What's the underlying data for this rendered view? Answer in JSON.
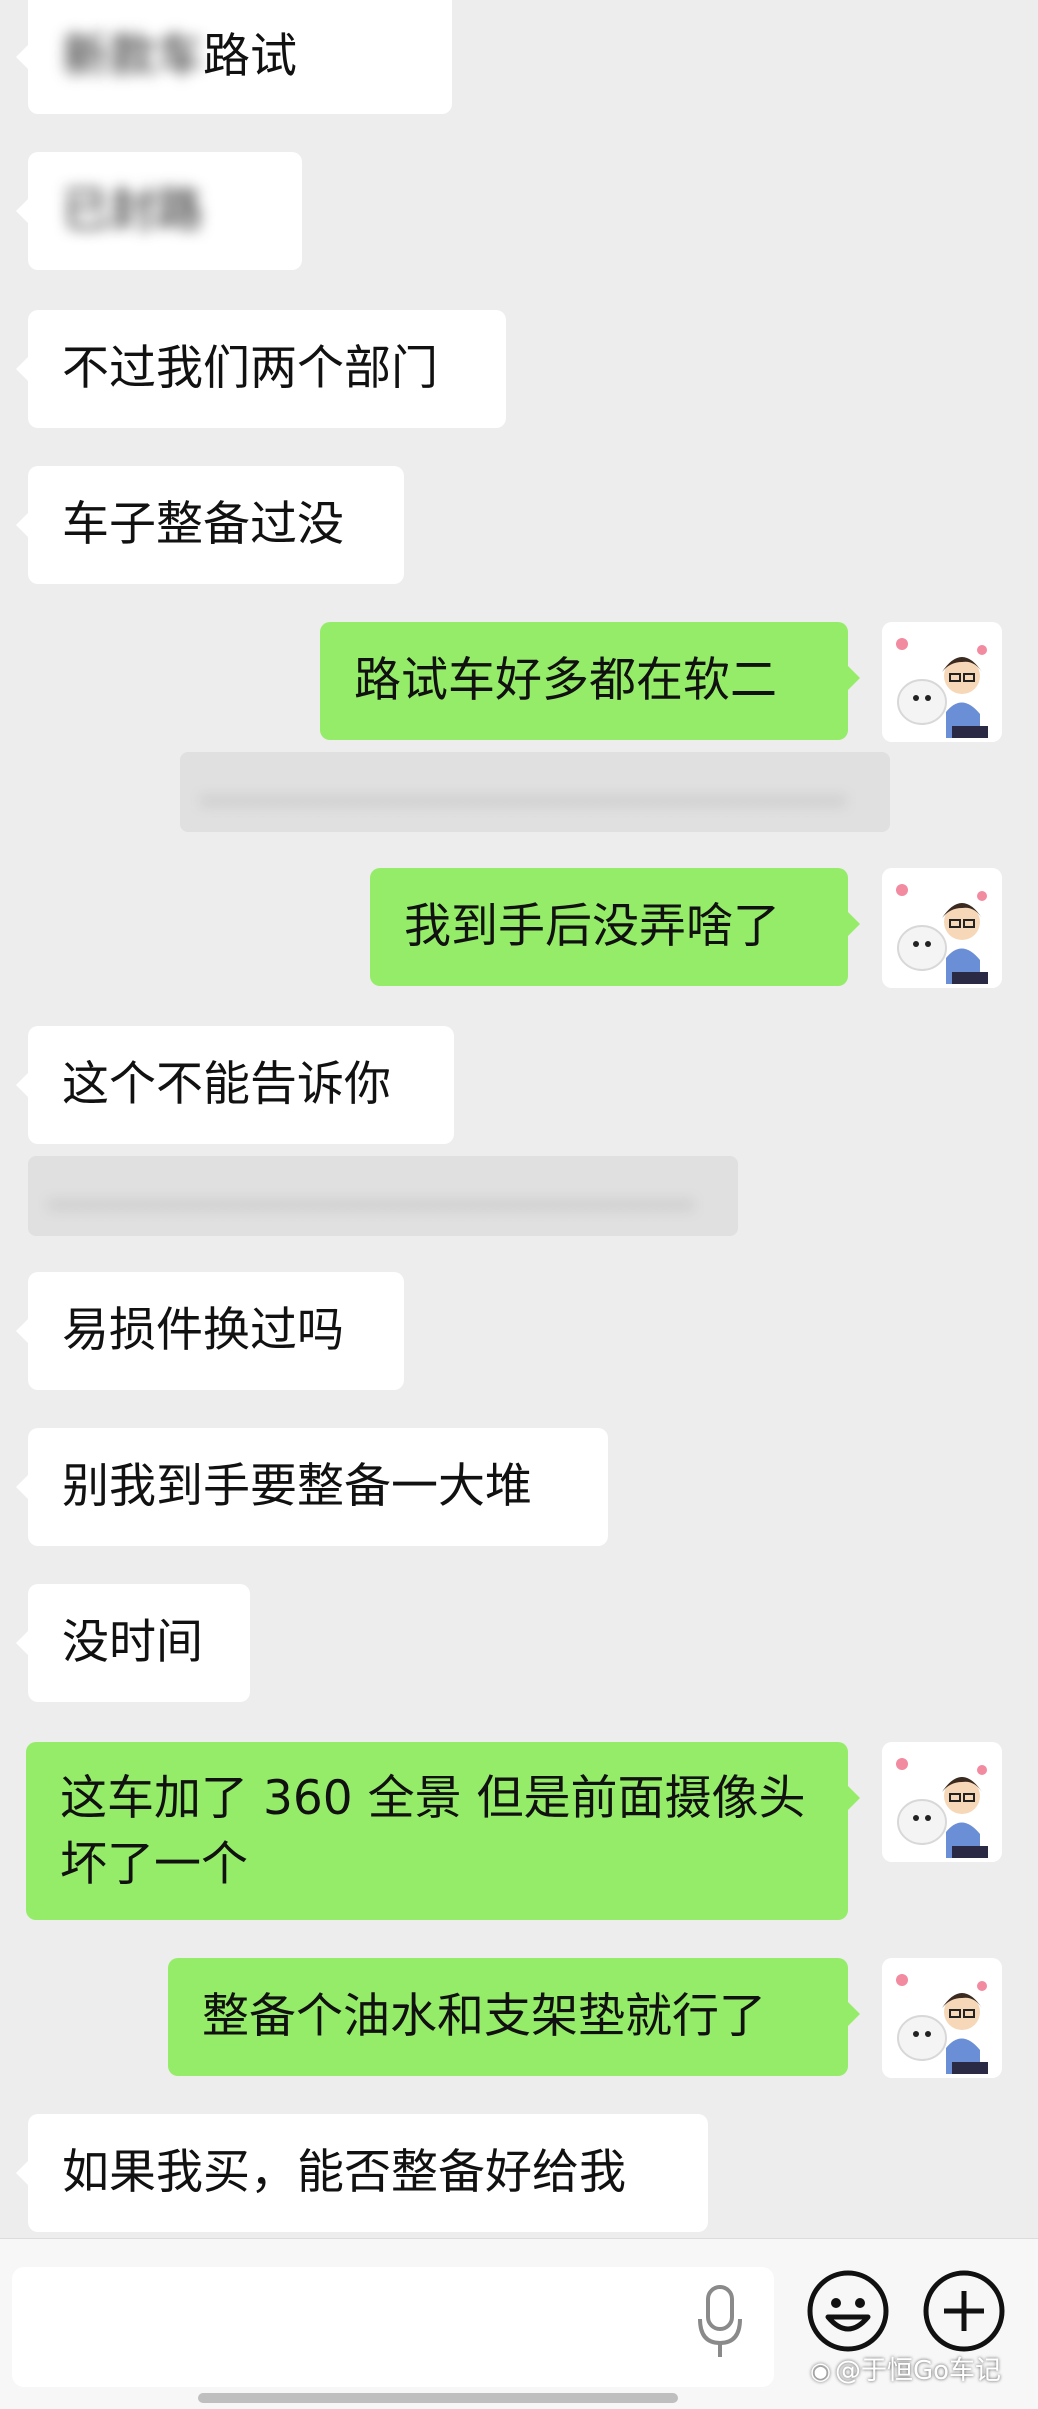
{
  "messages": {
    "m1": {
      "visible_text": "路试"
    },
    "m2": {
      "text": "不过我们两个部门"
    },
    "m3": {
      "text": "车子整备过没"
    },
    "m4": {
      "text": "路试车好多都在软二"
    },
    "m5": {
      "text": "我到手后没弄啥了"
    },
    "m6": {
      "text": "这个不能告诉你"
    },
    "m7": {
      "text": "易损件换过吗"
    },
    "m8": {
      "text": "别我到手要整备一大堆"
    },
    "m9": {
      "text": "没时间"
    },
    "m10": {
      "text": "这车加了 360 全景 但是前面摄像头坏了一个"
    },
    "m11": {
      "text": "整备个油水和支架垫就行了"
    },
    "m12": {
      "text": "如果我买，能否整备好给我"
    }
  },
  "input_bar": {
    "mic_icon": "microphone-icon",
    "emoji_icon": "smiley-face-icon",
    "plus_icon": "plus-circle-icon"
  },
  "watermark": {
    "icon": "weibo-logo-icon",
    "text": "@于恒Go车记"
  },
  "colors": {
    "background": "#ededed",
    "bubble_incoming": "#ffffff",
    "bubble_outgoing": "#95ec69",
    "text": "#111111"
  }
}
